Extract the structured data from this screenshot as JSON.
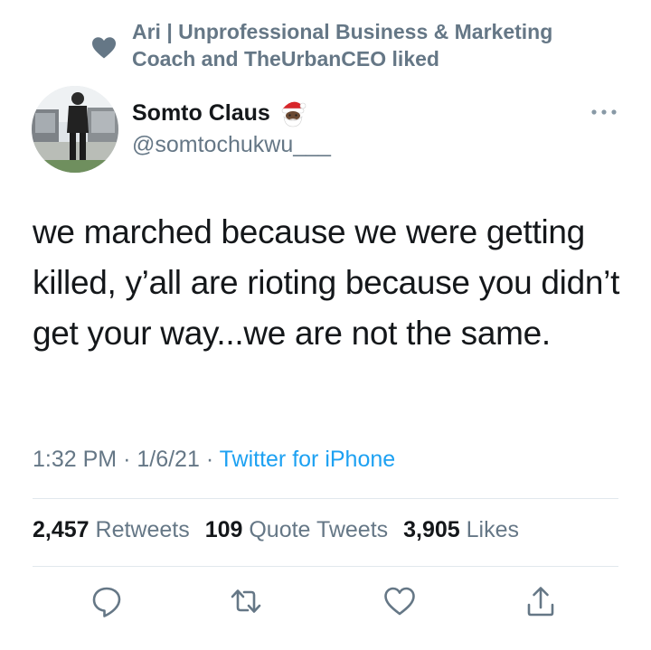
{
  "social_context": {
    "icon": "heart-icon",
    "text": "Ari | Unprofessional Business & Marketing Coach and TheUrbanCEO liked"
  },
  "author": {
    "display_name": "Somto Claus",
    "emoji": "santa-emoji",
    "handle": "@somtochukwu___"
  },
  "tweet": {
    "text": "we marched because we were getting killed, y’all are rioting because you didn’t get your way...we are not the same."
  },
  "meta": {
    "time": "1:32 PM",
    "sep1": "·",
    "date": "1/6/21",
    "sep2": "·",
    "source": "Twitter for iPhone"
  },
  "stats": {
    "retweets_count": "2,457",
    "retweets_label": "Retweets",
    "quotes_count": "109",
    "quotes_label": "Quote Tweets",
    "likes_count": "3,905",
    "likes_label": "Likes"
  },
  "colors": {
    "text": "#14171a",
    "secondary": "#657786",
    "link": "#1da1f2",
    "divider": "#e1e8ed"
  },
  "actions": [
    "reply-icon",
    "retweet-icon",
    "like-icon",
    "share-icon"
  ]
}
